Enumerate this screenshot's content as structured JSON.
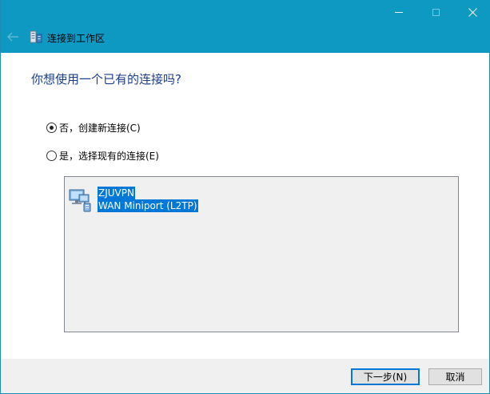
{
  "window": {
    "title": "连接到工作区",
    "titlebar_color": "#0d99c1",
    "controls": {
      "minimize": "minimize-icon",
      "maximize": "maximize-icon",
      "close": "close-icon"
    }
  },
  "main": {
    "heading": "你想使用一个已有的连接吗?",
    "options": [
      {
        "label": "否，创建新连接(C)",
        "selected": true
      },
      {
        "label": "是，选择现有的连接(E)",
        "selected": false
      }
    ],
    "connections": [
      {
        "name": "ZJUVPN",
        "device": "WAN Miniport (L2TP)",
        "selected": true,
        "icon": "network-connection-icon"
      }
    ]
  },
  "footer": {
    "next_label": "下一步(N)",
    "cancel_label": "取消"
  },
  "colors": {
    "heading": "#1b3e8c",
    "selection": "#0078d7"
  }
}
